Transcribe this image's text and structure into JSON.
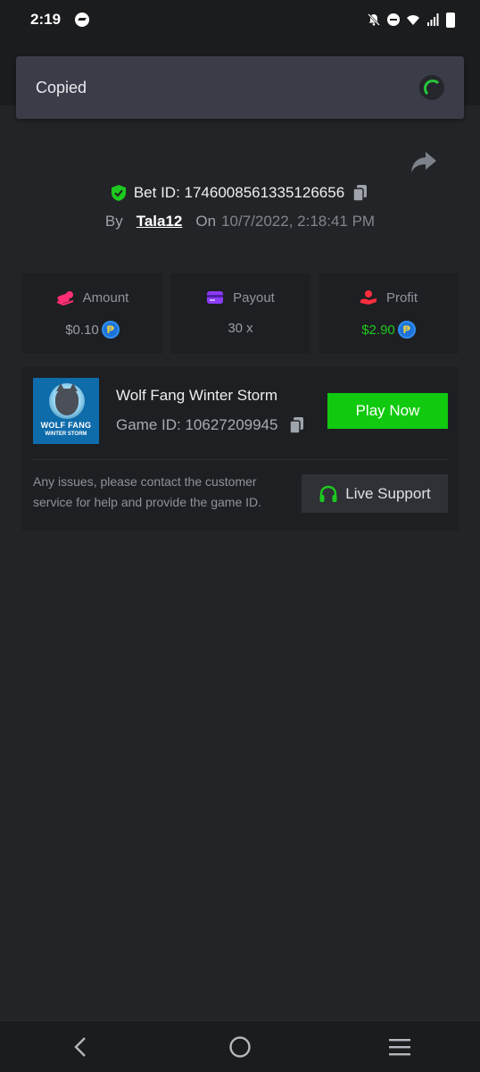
{
  "status_bar": {
    "time": "2:19"
  },
  "toast": {
    "text": "Copied"
  },
  "bet": {
    "id_label": "Bet ID: 1746008561335126656",
    "by_label": "By",
    "user": "Tala12",
    "on_label": "On",
    "date": "10/7/2022, 2:18:41 PM"
  },
  "stats": [
    {
      "label": "Amount",
      "value": "$0.10",
      "coin": "₱"
    },
    {
      "label": "Payout",
      "value": "30 x"
    },
    {
      "label": "Profit",
      "value": "$2.90",
      "coin": "₱"
    }
  ],
  "game": {
    "thumb_title": "WOLF FANG",
    "thumb_subtitle": "WINTER STORM",
    "name": "Wolf Fang Winter Storm",
    "id_label": "Game ID: 10627209945",
    "play_label": "Play Now"
  },
  "support": {
    "help_text": "Any issues, please contact the customer service for help and provide the game ID.",
    "button_label": "Live Support"
  },
  "colors": {
    "accent_green": "#11c90f",
    "profit_green": "#1ec91f",
    "amount_icon": "#ff2d74",
    "payout_icon": "#8b3cf7",
    "profit_icon": "#ff2e3e"
  },
  "icons": [
    "messenger-icon",
    "notifications-off-icon",
    "dnd-icon",
    "wifi-icon",
    "signal-icon",
    "battery-icon",
    "share-icon",
    "shield-check-icon",
    "copy-icon",
    "coin-icon",
    "headset-icon",
    "back-icon",
    "home-icon",
    "menu-icon"
  ]
}
